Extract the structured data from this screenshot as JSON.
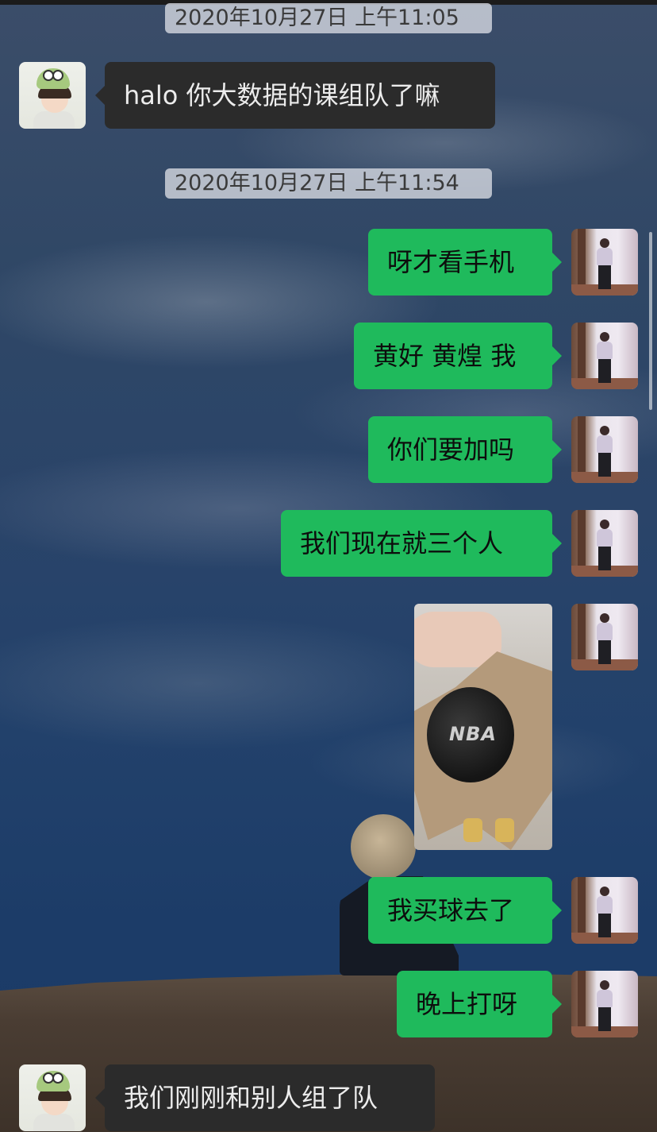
{
  "chat": {
    "timestamps": [
      "2020年10月27日 上午11:05",
      "2020年10月27日 上午11:54"
    ],
    "messages": [
      {
        "side": "left",
        "text": "halo 你大数据的课组队了嘛"
      },
      {
        "side": "right",
        "text": "呀才看手机"
      },
      {
        "side": "right",
        "text": "黄好 黄煌 我"
      },
      {
        "side": "right",
        "text": "你们要加吗"
      },
      {
        "side": "right",
        "text": "我们现在就三个人"
      },
      {
        "side": "right",
        "type": "image",
        "text": "NBA"
      },
      {
        "side": "right",
        "text": "我买球去了"
      },
      {
        "side": "right",
        "text": "晚上打呀"
      },
      {
        "side": "left",
        "text": "我们刚刚和别人组了队"
      }
    ]
  },
  "colors": {
    "self_bubble": "#1fba5c",
    "other_bubble": "#2b2b2b",
    "timestamp_bg": "#d2d6de"
  },
  "icons": {
    "other_avatar": "avatar-child-green-hat",
    "self_avatar": "avatar-girl-room"
  }
}
